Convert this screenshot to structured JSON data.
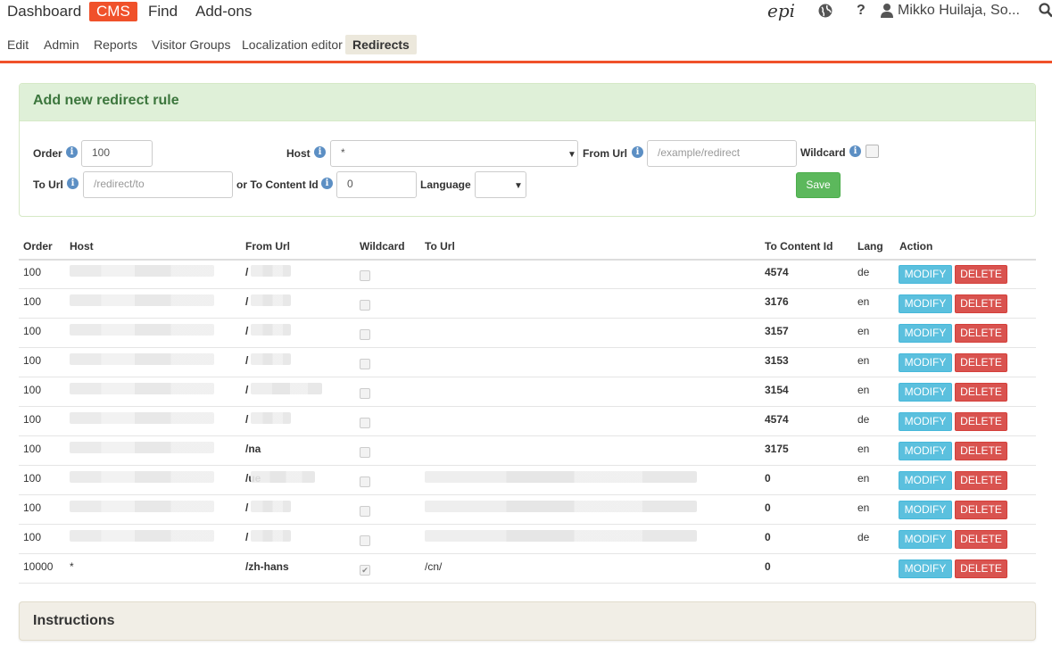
{
  "topnav": {
    "items": [
      "Dashboard",
      "CMS",
      "Find",
      "Add-ons"
    ],
    "logo_text": "epi",
    "help_label": "?",
    "user_name": "Mikko Huilaja, So..."
  },
  "subnav": {
    "items": [
      "Edit",
      "Admin",
      "Reports",
      "Visitor Groups",
      "Localization editor",
      "Redirects"
    ]
  },
  "colors": {
    "accent": "#f0512a",
    "panel_header_bg": "#dff0d8",
    "panel_title": "#3c763d",
    "save_button": "#5cb85c",
    "modify_button": "#5bc0de",
    "delete_button": "#d9534f"
  },
  "form": {
    "title": "Add new redirect rule",
    "order_label": "Order",
    "order_value": "100",
    "host_label": "Host",
    "host_value": "*",
    "from_url_label": "From Url",
    "from_url_placeholder": "/example/redirect",
    "wildcard_label": "Wildcard",
    "to_url_label": "To Url",
    "to_url_placeholder": "/redirect/to",
    "to_content_label": "or To Content Id",
    "to_content_value": "0",
    "language_label": "Language",
    "language_value": "",
    "save_label": "Save",
    "info_glyph": "i"
  },
  "table": {
    "headers": {
      "order": "Order",
      "host": "Host",
      "from_url": "From Url",
      "wildcard": "Wildcard",
      "to_url": "To Url",
      "to_content_id": "To Content Id",
      "lang": "Lang",
      "action": "Action"
    },
    "modify_label": "MODIFY",
    "delete_label": "DELETE",
    "rows": [
      {
        "order": "100",
        "host": "",
        "from_url": "/",
        "wildcard": false,
        "to_url": "",
        "content_id": "4574",
        "lang": "de"
      },
      {
        "order": "100",
        "host": "",
        "from_url": "/",
        "wildcard": false,
        "to_url": "",
        "content_id": "3176",
        "lang": "en"
      },
      {
        "order": "100",
        "host": "",
        "from_url": "/",
        "wildcard": false,
        "to_url": "",
        "content_id": "3157",
        "lang": "en"
      },
      {
        "order": "100",
        "host": "",
        "from_url": "/",
        "wildcard": false,
        "to_url": "",
        "content_id": "3153",
        "lang": "en"
      },
      {
        "order": "100",
        "host": "",
        "from_url": "/",
        "wildcard": false,
        "to_url": "",
        "content_id": "3154",
        "lang": "en"
      },
      {
        "order": "100",
        "host": "",
        "from_url": "/",
        "wildcard": false,
        "to_url": "",
        "content_id": "4574",
        "lang": "de"
      },
      {
        "order": "100",
        "host": "",
        "from_url": "/na",
        "wildcard": false,
        "to_url": "",
        "content_id": "3175",
        "lang": "en"
      },
      {
        "order": "100",
        "host": "",
        "from_url": "/ue",
        "wildcard": false,
        "to_url": "",
        "content_id": "0",
        "lang": "en"
      },
      {
        "order": "100",
        "host": "",
        "from_url": "/",
        "wildcard": false,
        "to_url": "",
        "content_id": "0",
        "lang": "en"
      },
      {
        "order": "100",
        "host": "",
        "from_url": "/",
        "wildcard": false,
        "to_url": "",
        "content_id": "0",
        "lang": "de"
      },
      {
        "order": "10000",
        "host": "*",
        "from_url": "/zh-hans",
        "wildcard": true,
        "to_url": "/cn/",
        "content_id": "0",
        "lang": ""
      }
    ]
  },
  "instructions": {
    "title": "Instructions"
  }
}
